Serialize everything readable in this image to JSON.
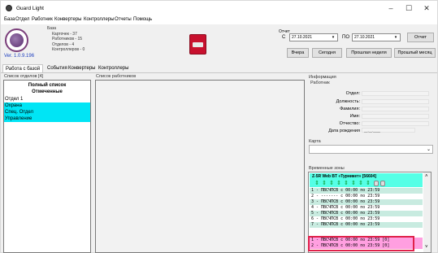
{
  "window": {
    "title": "Guard Light",
    "minimize": "–",
    "maximize": "☐",
    "close": "✕"
  },
  "menu": [
    "База",
    "Отдел",
    "Работник",
    "Конвертеры",
    "Контроллеры",
    "Отчеты",
    "Помощь"
  ],
  "app": {
    "version": "Ver. 1.0.9.196",
    "base_label": "База",
    "stats": [
      "Карточек - 37",
      "Работников - 15",
      "Отделов - 4",
      "Контроллеров - 0"
    ]
  },
  "report": {
    "label": "Отчет",
    "from_label": "С",
    "to_label": "ПО",
    "from_date": "27.10.2021",
    "to_date": "27.10.2021",
    "report_button": "Отчет",
    "yesterday": "Вчера",
    "today": "Сегодня",
    "last_week": "Прошлая неделя",
    "last_month": "Прошлый месяц"
  },
  "tabs": [
    "Работа с базой",
    "События",
    "Конвертеры",
    "Контроллеры"
  ],
  "departments": {
    "title": "Список отделов [4]",
    "header_all": "Полный список",
    "header_marked": "Отмеченные",
    "items": [
      "Отдел 1",
      "Охрана",
      "Спец. Отдел",
      "Управление"
    ]
  },
  "employees": {
    "title": "Список работников"
  },
  "info": {
    "title": "Информация",
    "worker_label": "Работник",
    "fields": [
      "Отдел:",
      "Должность:",
      "Фамилия:",
      "Имя:",
      "Отчество:",
      "Дата рождения"
    ],
    "birth_placeholder": "__.__.____"
  },
  "card": {
    "label": "Карта"
  },
  "time_zones": {
    "label": "Временные зоны",
    "header": "Z-5R Web BT «Турникет» [56604]",
    "rows": [
      "1 - ПВСЧПСВ с 00:00 по 23:59",
      "2 - ------- с 00:00 по 23:59",
      "3 - ПВСЧПСВ с 00:00 по 23:59",
      "4 - ПВСЧПСВ с 00:00 по 23:59",
      "5 - ПВСЧПСВ с 00:00 по 23:59",
      "6 - ПВСЧПСВ с 00:00 по 23:59",
      "7 - ПВСЧПСВ с 00:00 по 23:59",
      "1 - ПВСЧПСВ с 00:00 по 23:59 [0]",
      "2 - ПВСЧПСВ с 00:00 по 23:59 [0]"
    ]
  },
  "colors": {
    "dept_row": "#00e5f5",
    "zone_header": "#55ffe6",
    "row_green": "#c8ebe0",
    "row_pink": "#ff9fe0",
    "highlight_border": "#e0214a",
    "version": "#1e3fbf"
  }
}
